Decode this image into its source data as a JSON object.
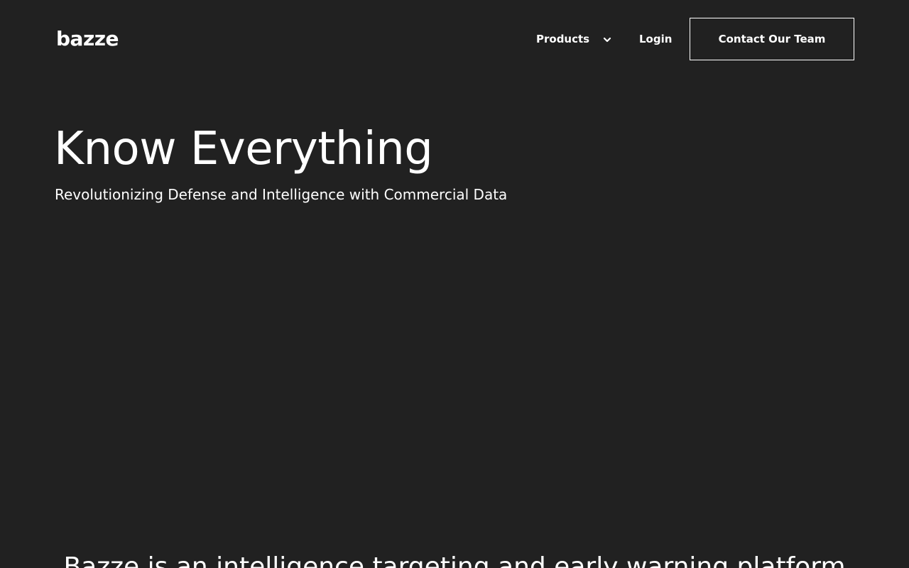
{
  "brand": {
    "logo_text": "bazze"
  },
  "nav": {
    "products_label": "Products",
    "login_label": "Login",
    "contact_label": "Contact Our Team"
  },
  "hero": {
    "title": "Know Everything",
    "subtitle": "Revolutionizing Defense and Intelligence with Commercial Data"
  },
  "intro": {
    "text": "Bazze is an intelligence targeting and early warning platform"
  },
  "icons": {
    "products_chevron": "chevron-down-icon"
  },
  "colors": {
    "background": "#212121",
    "text": "#ffffff",
    "button_border": "#ffffff"
  }
}
